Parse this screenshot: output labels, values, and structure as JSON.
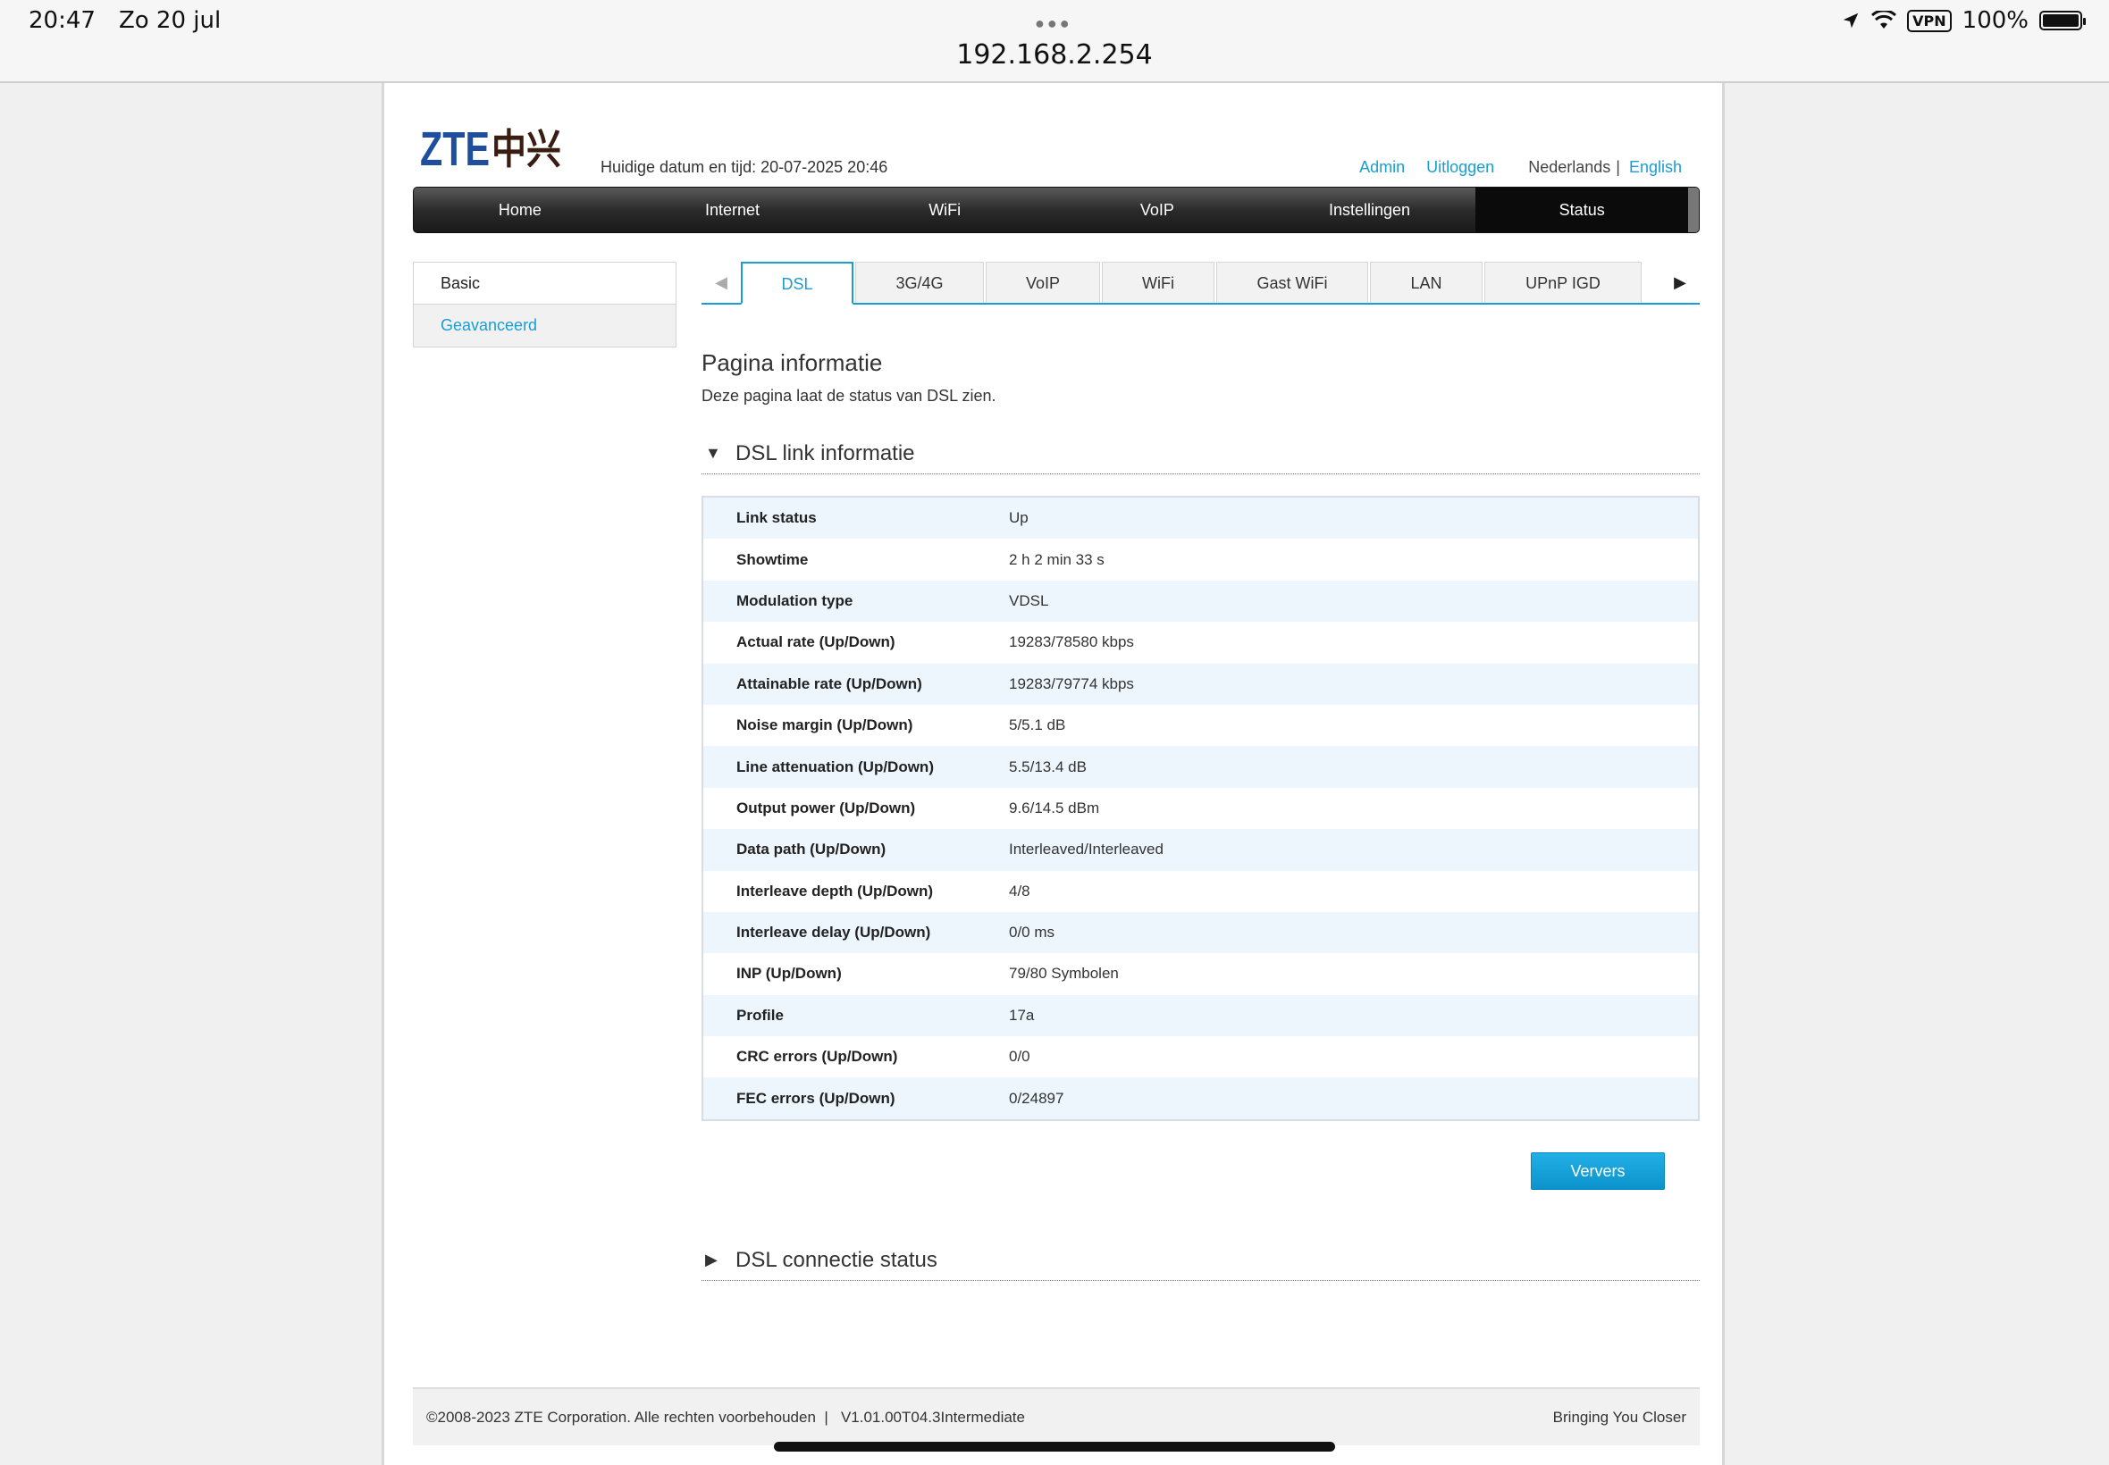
{
  "ios": {
    "time": "20:47",
    "date": "Zo 20 jul",
    "url": "192.168.2.254",
    "vpn": "VPN",
    "battery": "100%",
    "battery_level": 1.0
  },
  "header": {
    "logo_text": "ZTE中兴",
    "datetime": "Huidige datum en tijd: 20-07-2025 20:46",
    "admin": "Admin",
    "logout": "Uitloggen",
    "lang_nl": "Nederlands",
    "lang_sep": "|",
    "lang_en": "English"
  },
  "nav": [
    "Home",
    "Internet",
    "WiFi",
    "VoIP",
    "Instellingen",
    "Status"
  ],
  "sidebar": {
    "basic": "Basic",
    "advanced": "Geavanceerd"
  },
  "tabs": [
    "DSL",
    "3G/4G",
    "VoIP",
    "WiFi",
    "Gast WiFi",
    "LAN",
    "UPnP IGD"
  ],
  "main": {
    "title": "Pagina informatie",
    "description": "Deze pagina laat de status van DSL zien.",
    "section1": "DSL link informatie",
    "section2": "DSL connectie status",
    "refresh": "Ververs"
  },
  "rows": [
    {
      "label": "Link status",
      "value": "Up"
    },
    {
      "label": "Showtime",
      "value": "2 h 2 min 33 s"
    },
    {
      "label": "Modulation type",
      "value": "VDSL"
    },
    {
      "label": "Actual rate (Up/Down)",
      "value": "19283/78580 kbps"
    },
    {
      "label": "Attainable rate (Up/Down)",
      "value": "19283/79774 kbps"
    },
    {
      "label": "Noise margin (Up/Down)",
      "value": "5/5.1 dB"
    },
    {
      "label": "Line attenuation (Up/Down)",
      "value": "5.5/13.4 dB"
    },
    {
      "label": "Output power (Up/Down)",
      "value": "9.6/14.5 dBm"
    },
    {
      "label": "Data path (Up/Down)",
      "value": "Interleaved/Interleaved"
    },
    {
      "label": "Interleave depth (Up/Down)",
      "value": "4/8"
    },
    {
      "label": "Interleave delay (Up/Down)",
      "value": "0/0 ms"
    },
    {
      "label": "INP (Up/Down)",
      "value": "79/80 Symbolen"
    },
    {
      "label": "Profile",
      "value": "17a"
    },
    {
      "label": "CRC errors (Up/Down)",
      "value": "0/0"
    },
    {
      "label": "FEC errors (Up/Down)",
      "value": "0/24897"
    }
  ],
  "footer": {
    "copyright": "©2008-2023 ZTE Corporation. Alle rechten voorbehouden  |   V1.01.00T04.3Intermediate",
    "slogan": "Bringing You Closer"
  },
  "colors": {
    "accent": "#1a9dd3",
    "navbar": "#2b2b2b",
    "row_alt": "#edf6fd",
    "logo_blue": "#1f4e9c"
  }
}
